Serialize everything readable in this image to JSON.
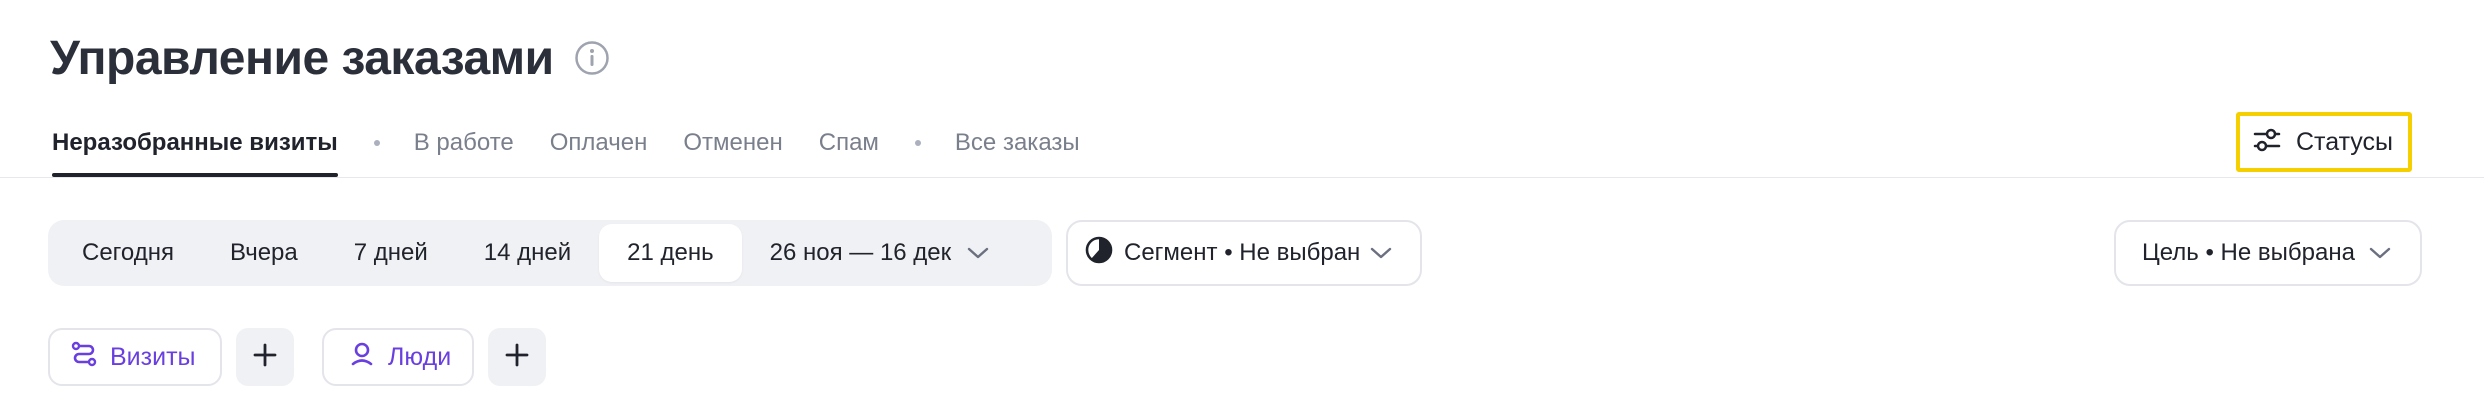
{
  "header": {
    "title": "Управление заказами"
  },
  "tabs": [
    {
      "label": "Неразобранные визиты",
      "active": true
    },
    {
      "label": "В работе"
    },
    {
      "label": "Оплачен"
    },
    {
      "label": "Отменен"
    },
    {
      "label": "Спам"
    },
    {
      "label": "Все заказы"
    }
  ],
  "statuses_button": {
    "label": "Статусы",
    "icon": "sliders-icon",
    "highlight_color": "#f5cf00"
  },
  "periods": [
    {
      "label": "Сегодня"
    },
    {
      "label": "Вчера"
    },
    {
      "label": "7 дней"
    },
    {
      "label": "14 дней"
    },
    {
      "label": "21 день",
      "active": true
    }
  ],
  "date_range": {
    "label": "26 ноя — 16 дек"
  },
  "segment": {
    "label": "Сегмент • Не выбран",
    "icon": "pie-chart-icon"
  },
  "goal": {
    "label": "Цель • Не выбрана"
  },
  "chips": [
    {
      "label": "Визиты",
      "icon": "route-icon"
    },
    {
      "label": "Люди",
      "icon": "person-icon"
    }
  ],
  "colors": {
    "accent_purple": "#6a3fe0",
    "text_primary": "#20232c",
    "text_secondary": "#7a7f8c",
    "pill_bg": "#f0f1f4"
  }
}
